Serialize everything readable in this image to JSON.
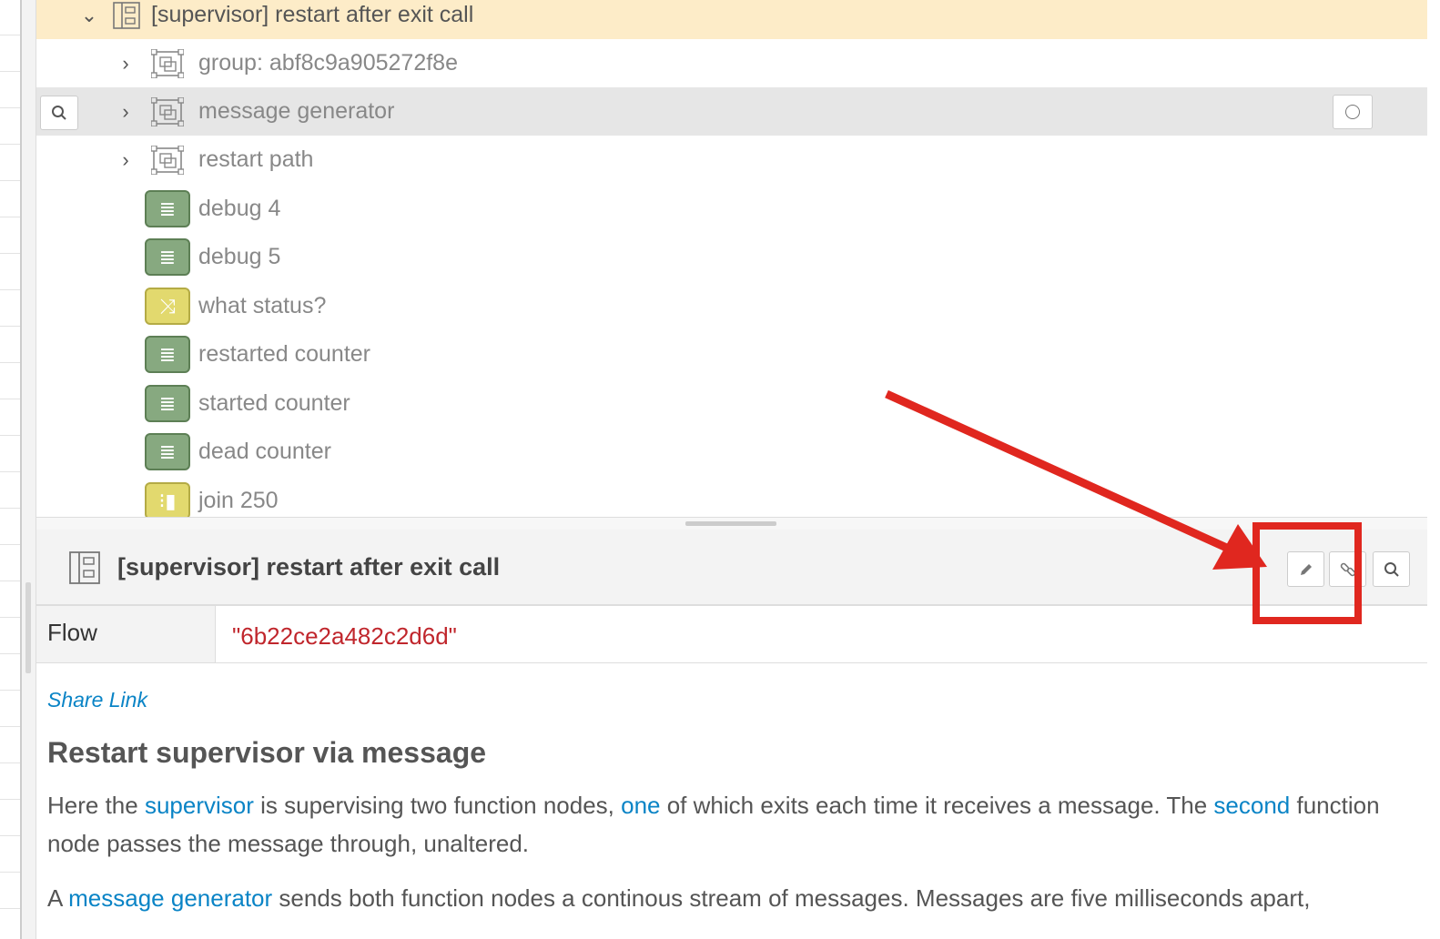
{
  "tree": {
    "flow_title": "[supervisor] restart after exit call",
    "groups": [
      {
        "label": "group: abf8c9a905272f8e"
      },
      {
        "label": "message generator"
      },
      {
        "label": "restart path"
      }
    ],
    "nodes": [
      {
        "label": "debug 4",
        "color": "green",
        "icon": "debug-icon"
      },
      {
        "label": "debug 5",
        "color": "green",
        "icon": "debug-icon"
      },
      {
        "label": "what status?",
        "color": "yellow",
        "icon": "switch-icon"
      },
      {
        "label": "restarted counter",
        "color": "green",
        "icon": "debug-icon"
      },
      {
        "label": "started counter",
        "color": "green",
        "icon": "debug-icon"
      },
      {
        "label": "dead counter",
        "color": "green",
        "icon": "debug-icon"
      },
      {
        "label": "join 250",
        "color": "yellow",
        "icon": "join-icon"
      }
    ]
  },
  "info": {
    "title": "[supervisor] restart after exit call",
    "buttons": [
      "edit-icon",
      "link-icon",
      "search-icon"
    ],
    "property_key": "Flow",
    "property_value": "\"6b22ce2a482c2d6d\"",
    "share_link": "Share Link",
    "heading": "Restart supervisor via message",
    "p1": {
      "t1": "Here the ",
      "l1": "supervisor",
      "t2": " is supervising two function nodes, ",
      "l2": "one",
      "t3": " of which exits each time it receives a message. The ",
      "l3": "second",
      "t4": " function node passes the message through, unaltered."
    },
    "p2": {
      "t1": "A ",
      "l1": "message generator",
      "t2": " sends both function nodes a continous stream of messages. Messages are five milliseconds apart,"
    }
  },
  "colors": {
    "selected_row": "#fdecc8",
    "debug_node": "#87a980",
    "function_node": "#e2d96e",
    "link": "#0a84c6",
    "property_value": "#c0262c",
    "annotation": "#e0271f"
  }
}
